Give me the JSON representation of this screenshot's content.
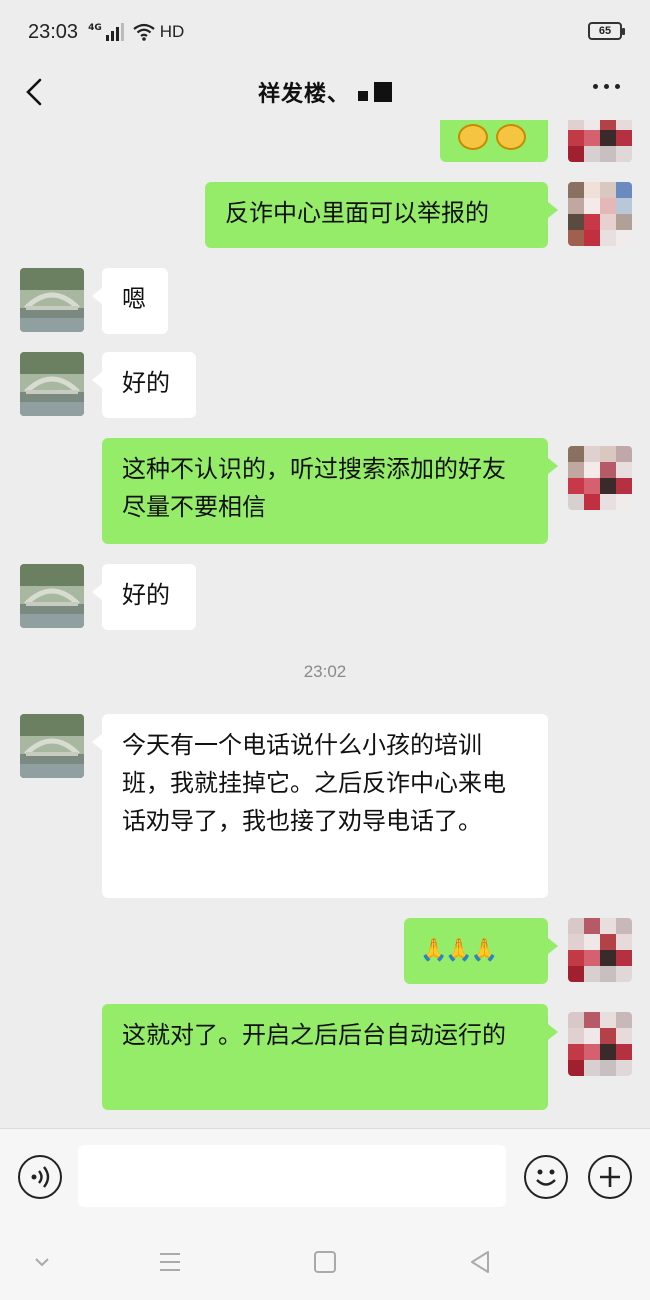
{
  "status_bar": {
    "time": "23:03",
    "network": "4G",
    "hd_label": "HD",
    "battery": "65"
  },
  "header": {
    "title": "祥发楼、"
  },
  "colors": {
    "sent_bubble": "#95ec69",
    "received_bubble": "#ffffff",
    "background": "#ededed"
  },
  "messages": [
    {
      "side": "sent",
      "text": "反诈中心里面可以举报的"
    },
    {
      "side": "received",
      "text": "嗯"
    },
    {
      "side": "received",
      "text": "好的"
    },
    {
      "side": "sent",
      "text": "这种不认识的，听过搜索添加的好友尽量不要相信"
    },
    {
      "side": "received",
      "text": "好的"
    },
    {
      "side": "received",
      "text": "今天有一个电话说什么小孩的培训班，我就挂掉它。之后反诈中心来电话劝导了，我也接了劝导电话了。"
    },
    {
      "side": "sent",
      "text": "🙏🙏🙏"
    },
    {
      "side": "sent",
      "text": "这就对了。开启之后后台自动运行的"
    }
  ],
  "timestamp": "23:02",
  "input": {
    "placeholder": ""
  },
  "icons": {
    "back": "chevron-left-icon",
    "more": "more-dots-icon",
    "voice": "voice-icon",
    "emoji": "emoji-icon",
    "plus": "plus-icon"
  }
}
